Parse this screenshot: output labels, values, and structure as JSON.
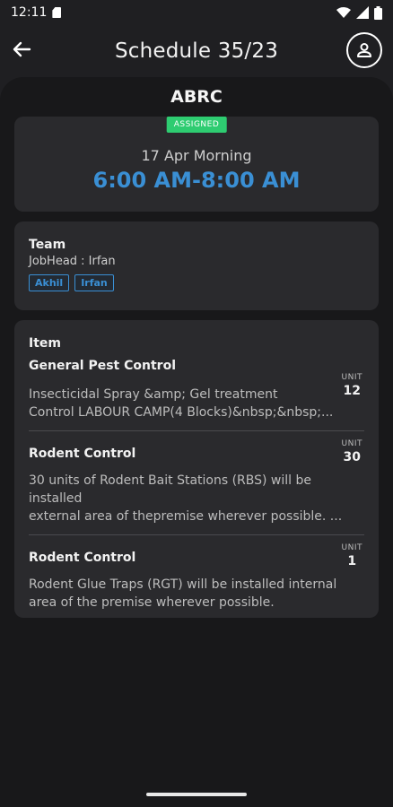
{
  "status_bar": {
    "time": "12:11"
  },
  "header": {
    "title": "Schedule 35/23"
  },
  "client_name": "ABRC",
  "schedule": {
    "status": "ASSIGNED",
    "date": "17 Apr Morning",
    "time_range": "6:00 AM-8:00 AM"
  },
  "team": {
    "title": "Team",
    "job_head": "JobHead : Irfan",
    "members": [
      "Akhil",
      "Irfan"
    ]
  },
  "items": {
    "title": "Item",
    "unit_label": "UNIT",
    "list": [
      {
        "name": "General Pest Control",
        "unit": "12",
        "description": "Insecticidal Spray &amp; Gel treatment\nControl LABOUR CAMP(4 Blocks)&nbsp;&nbsp;..."
      },
      {
        "name": "Rodent Control",
        "unit": "30",
        "description": "30 units of Rodent Bait Stations (RBS) will be installed\nexternal area of thepremise wherever possible. ..."
      },
      {
        "name": "Rodent Control",
        "unit": "1",
        "description": "    Rodent Glue Traps (RGT) will be installed internal\narea of the premise  wherever possible."
      }
    ]
  },
  "colors": {
    "accent": "#3a8fd4",
    "badge": "#2ecc71",
    "background": "#18181a",
    "card": "#2a2a2d"
  }
}
